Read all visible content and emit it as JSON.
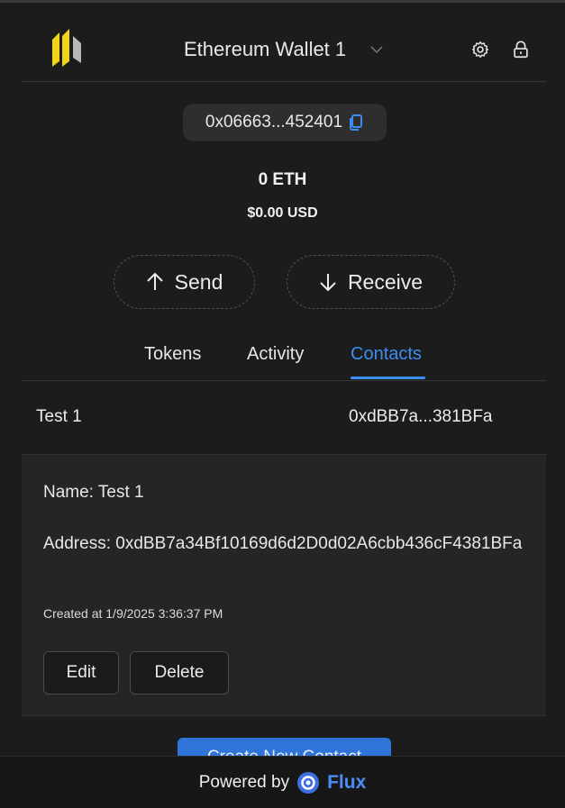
{
  "header": {
    "wallet_name": "Ethereum Wallet 1",
    "icons": [
      "app-logo-icon",
      "chevron-down-icon",
      "gear-icon",
      "lock-icon"
    ]
  },
  "account": {
    "address_short": "0x06663...452401",
    "balance_eth": "0 ETH",
    "balance_usd": "$0.00 USD"
  },
  "actions": {
    "send_label": "Send",
    "receive_label": "Receive"
  },
  "tabs": [
    {
      "label": "Tokens",
      "active": false
    },
    {
      "label": "Activity",
      "active": false
    },
    {
      "label": "Contacts",
      "active": true
    }
  ],
  "contacts": [
    {
      "name": "Test 1",
      "address_short": "0xdBB7a...381BFa"
    }
  ],
  "contact_detail": {
    "name_line": "Name: Test 1",
    "address_line": "Address: 0xdBB7a34Bf10169d6d2D0d02A6cbb436cF4381BFa",
    "created_line": "Created at 1/9/2025 3:36:37 PM",
    "edit_label": "Edit",
    "delete_label": "Delete"
  },
  "create_button_label": "Create New Contact",
  "footer": {
    "powered_by": "Powered by",
    "brand": "Flux"
  },
  "colors": {
    "background": "#1c1c1c",
    "accent": "#3b8ef0",
    "logo_yellow": "#f2d21b",
    "flux_blue": "#4b8cf5"
  }
}
